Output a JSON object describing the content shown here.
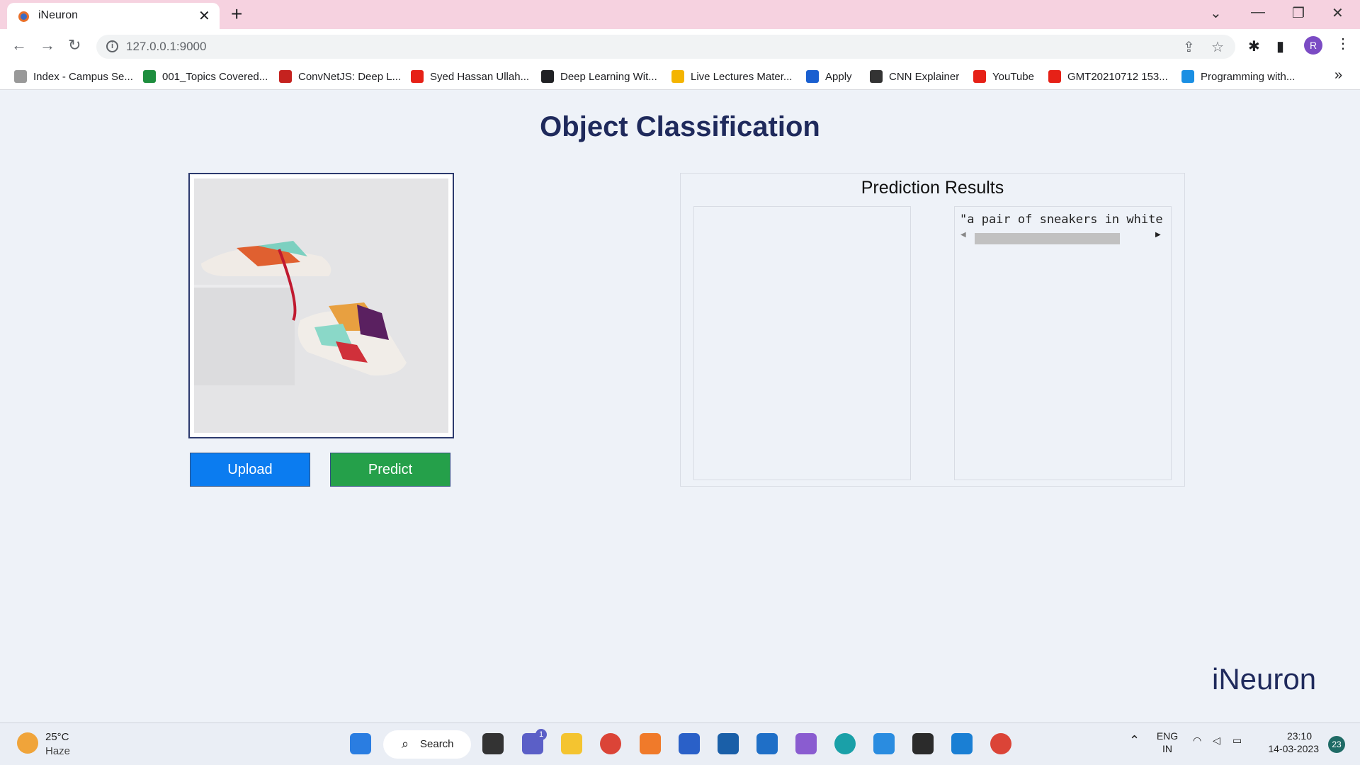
{
  "browser": {
    "tab_title": "iNeuron",
    "url": "127.0.0.1:9000",
    "bookmarks": [
      {
        "label": "Index - Campus Se...",
        "icon": "campus-icon",
        "color": "#999999"
      },
      {
        "label": "001_Topics Covered...",
        "icon": "sheets-icon",
        "color": "#1e8e3e"
      },
      {
        "label": "ConvNetJS: Deep L...",
        "icon": "convnet-icon",
        "color": "#c5221f"
      },
      {
        "label": "Syed Hassan Ullah...",
        "icon": "youtube-icon",
        "color": "#e62117"
      },
      {
        "label": "Deep Learning Wit...",
        "icon": "globe-icon",
        "color": "#202124"
      },
      {
        "label": "Live Lectures Mater...",
        "icon": "drive-icon",
        "color": "#f4b400"
      },
      {
        "label": "Apply",
        "icon": "apply-icon",
        "color": "#1a5fd0"
      },
      {
        "label": "CNN Explainer",
        "icon": "cnn-icon",
        "color": "#333333"
      },
      {
        "label": "YouTube",
        "icon": "youtube-icon",
        "color": "#e62117"
      },
      {
        "label": "GMT20210712 153...",
        "icon": "youtube-icon",
        "color": "#e62117"
      },
      {
        "label": "Programming with...",
        "icon": "is-icon",
        "color": "#1a8fe3"
      }
    ],
    "profile_initial": "R"
  },
  "page": {
    "title": "Object Classification",
    "upload_label": "Upload",
    "predict_label": "Predict",
    "results_title": "Prediction Results",
    "result_text": "\"a pair of sneakers in white ar",
    "logo_text": "iNeuron"
  },
  "taskbar": {
    "temperature": "25°C",
    "condition": "Haze",
    "search_label": "Search",
    "chat_badge": "1",
    "lang_line1": "ENG",
    "lang_line2": "IN",
    "time": "23:10",
    "date": "14-03-2023",
    "notification_count": "23"
  }
}
